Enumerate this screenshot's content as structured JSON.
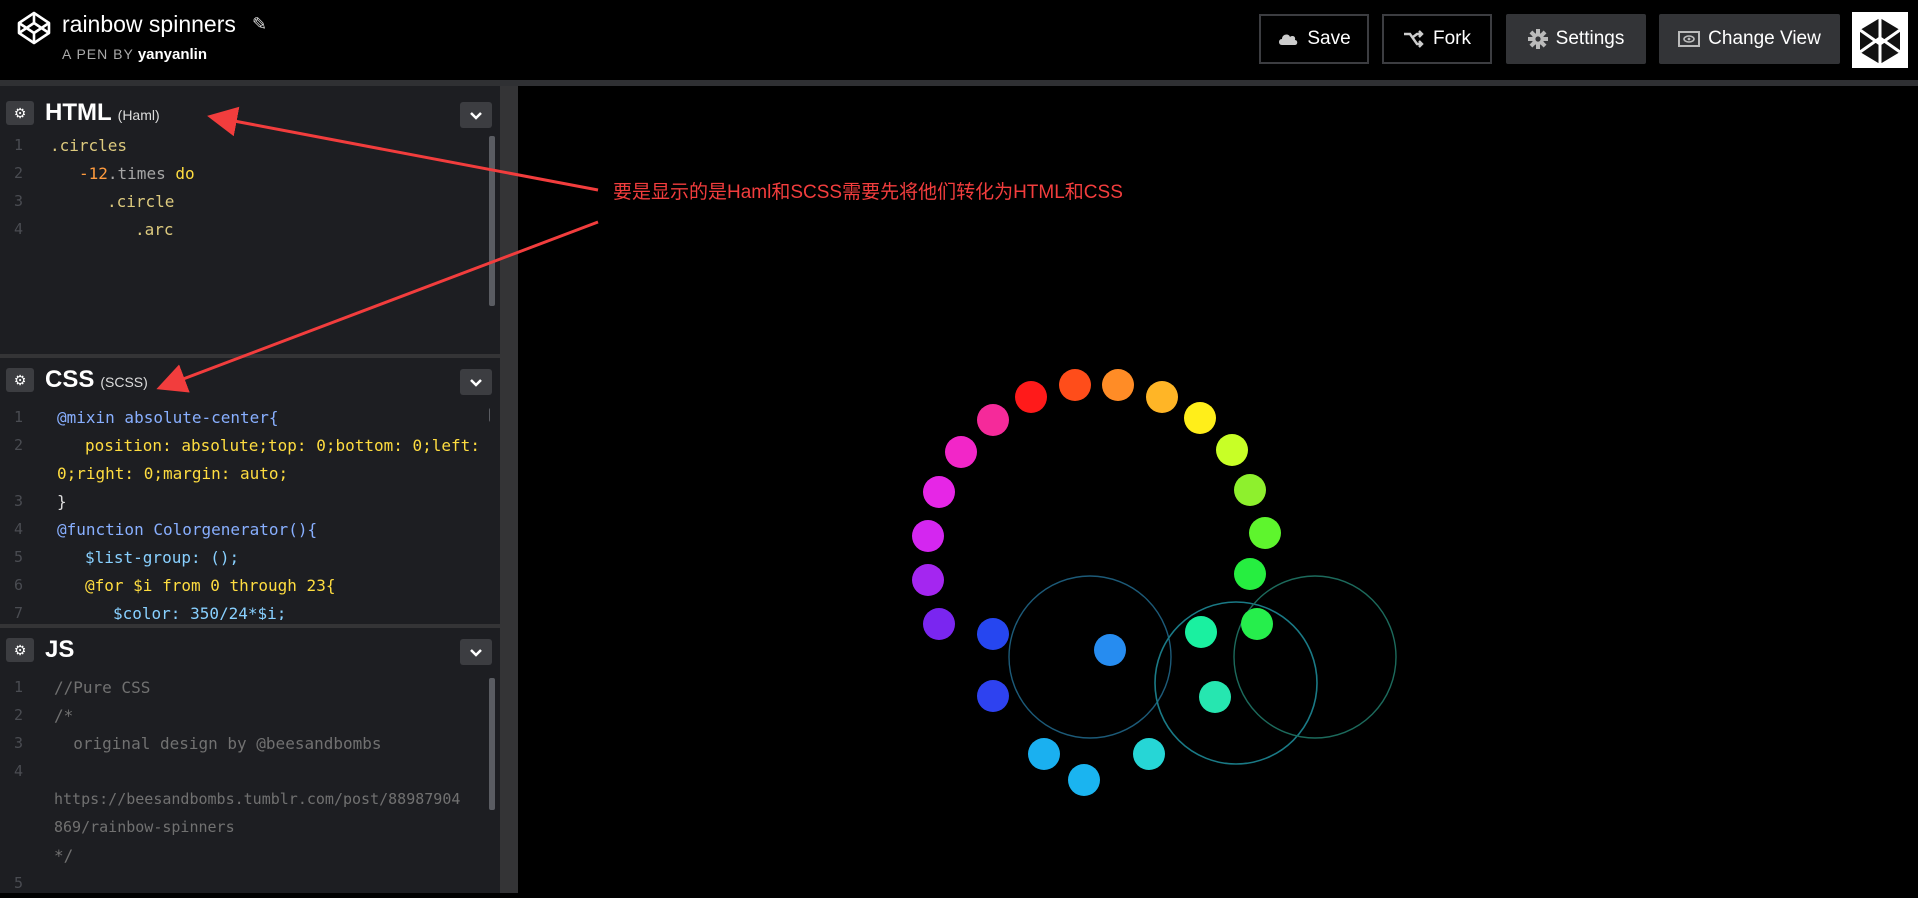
{
  "header": {
    "title": "rainbow spinners",
    "byline_prefix": "A PEN BY",
    "author": "yanyanlin",
    "buttons": {
      "save": "Save",
      "fork": "Fork",
      "settings": "Settings",
      "change_view": "Change View"
    }
  },
  "panels": {
    "html": {
      "title": "HTML",
      "subtitle": "(Haml)",
      "lines": [
        {
          "n": "1",
          "text": ".circles"
        },
        {
          "n": "2",
          "text_num": "12",
          "text_a": "-",
          "text_b": ".times",
          "text_c": " do"
        },
        {
          "n": "3",
          "text": ".circle"
        },
        {
          "n": "4",
          "text": ".arc"
        }
      ]
    },
    "css": {
      "title": "CSS",
      "subtitle": "(SCSS)",
      "lines": [
        {
          "n": "1",
          "text": "@mixin absolute-center{"
        },
        {
          "n": "2",
          "text": "position: absolute;top: 0;bottom: 0;left:"
        },
        {
          "n": "",
          "text": "0;right: 0;margin: auto;"
        },
        {
          "n": "3",
          "text": "}"
        },
        {
          "n": "4",
          "text": "@function Colorgenerator(){"
        },
        {
          "n": "5",
          "text": "$list-group: ();"
        },
        {
          "n": "6",
          "text": "@for $i from 0 through 23{"
        },
        {
          "n": "7",
          "text": "$color: 350/24*$i;"
        }
      ]
    },
    "js": {
      "title": "JS",
      "lines": [
        {
          "n": "1",
          "text": "//Pure CSS"
        },
        {
          "n": "2",
          "text": "/*"
        },
        {
          "n": "3",
          "text": "  original design by @beesandbombs"
        },
        {
          "n": "4",
          "text": ""
        },
        {
          "n": "",
          "text": "https://beesandbombs.tumblr.com/post/88987904"
        },
        {
          "n": "",
          "text": "869/rainbow-spinners"
        },
        {
          "n": "",
          "text": "*/"
        },
        {
          "n": "5",
          "text": ""
        }
      ]
    }
  },
  "annotation": "要是显示的是Haml和SCSS需要先将他们转化为HTML和CSS",
  "colors": {
    "accent_red": "#f23d3d",
    "dots": [
      "#ff1a1a",
      "#ff4d1a",
      "#ff8c26",
      "#ffb526",
      "#ffee1a",
      "#c8ff26",
      "#8ef02d",
      "#5ef52d",
      "#26ee40",
      "#26ee4c",
      "#1af0a0",
      "#26e6b0",
      "#26d6d6",
      "#1ab4f0",
      "#1ab0f0",
      "#268cf0",
      "#2646f0",
      "#2e42f0",
      "#7a26f0",
      "#a426f0",
      "#d426f0",
      "#e626e6",
      "#f226c8",
      "#f52a9a",
      "#ff2671"
    ]
  }
}
